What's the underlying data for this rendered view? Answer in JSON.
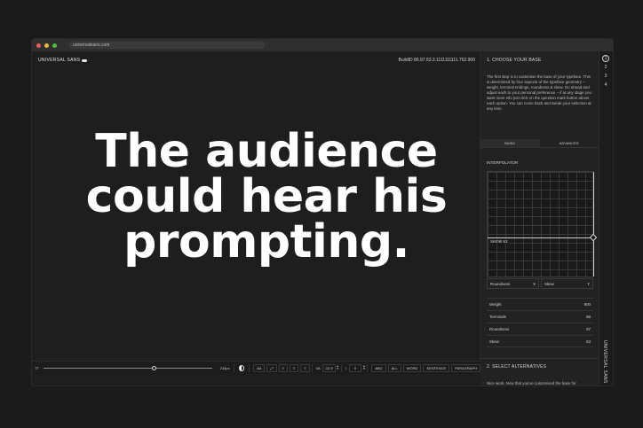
{
  "browser": {
    "url": "universalsans.com"
  },
  "canvas": {
    "brand": "UNIVERSAL SANS",
    "build_id": "BuildID 86.97.63.3.1111111111.762.900",
    "sample_text": "The audience could hear his prompting."
  },
  "toolbar": {
    "tt_label": "TT",
    "size_value": "233px",
    "size_fraction": 0.64,
    "aa_label": "AA",
    "va_label": "VA",
    "tracking_value": "-12.9",
    "leading_value": "0",
    "case_buttons": [
      "ABC",
      "ALL",
      "WORD",
      "SENTENCE",
      "PARAGRAPH"
    ]
  },
  "panel": {
    "step1_title": "1. CHOOSE YOUR BASE",
    "intro": "The first step is to customise the base of your typeface. This is determined by four aspects of the typeface geometry – weight, terminal endings, roundness & skew. Go ahead and adjust each to your personal preference – if at any stage you want more info just click on the question mark button above each option. You can come back and tweak your selection at any time.",
    "tabs": [
      {
        "label": "BASIC",
        "active": true
      },
      {
        "label": "ADVANCED",
        "active": false
      }
    ],
    "interpolator_label": "INTERPOLATOR",
    "skew_tag": "SKEW 63",
    "x_axis": {
      "name": "Roundness",
      "letter": "X"
    },
    "y_axis": {
      "name": "Skew",
      "letter": "Y"
    },
    "params": [
      {
        "name": "Weight",
        "value": "900"
      },
      {
        "name": "Terminals",
        "value": "88"
      },
      {
        "name": "Roundness",
        "value": "97"
      },
      {
        "name": "Skew",
        "value": "63"
      }
    ],
    "step2_title": "2. SELECT ALTERNATIVES",
    "step2_intro": "Nice work. Now that you've customised the base for"
  },
  "steps": {
    "items": [
      "1",
      "2",
      "3",
      "4"
    ],
    "active": "1",
    "vertical_brand": "UNIVERSAL SANS"
  }
}
